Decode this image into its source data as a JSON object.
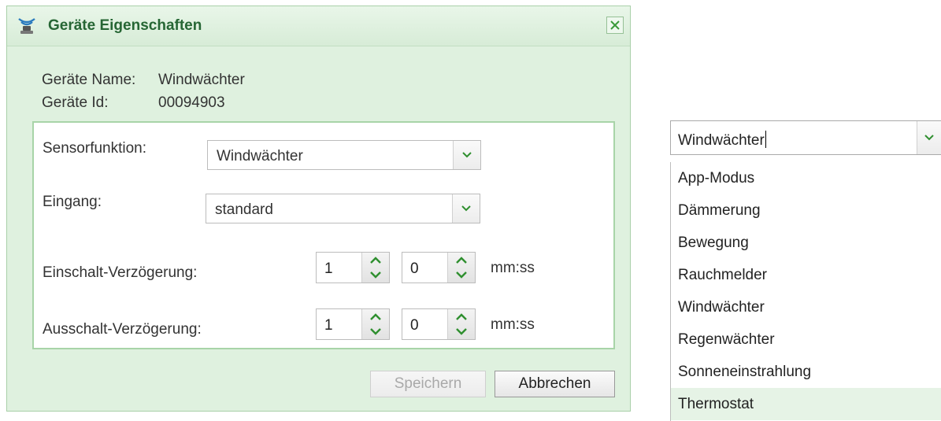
{
  "dialog": {
    "title": "Geräte Eigenschaften",
    "device_name_label": "Geräte Name:",
    "device_name_value": "Windwächter",
    "device_id_label": "Geräte Id:",
    "device_id_value": "00094903",
    "sensor_function": {
      "label": "Sensorfunktion:",
      "value": "Windwächter"
    },
    "input": {
      "label": "Eingang:",
      "value": "standard"
    },
    "on_delay": {
      "label": "Einschalt-Verzögerung:",
      "minutes": "1",
      "seconds": "0",
      "unit": "mm:ss"
    },
    "off_delay": {
      "label": "Ausschalt-Verzögerung:",
      "minutes": "1",
      "seconds": "0",
      "unit": "mm:ss"
    },
    "buttons": {
      "save": "Speichern",
      "cancel": "Abbrechen"
    }
  },
  "dropdown": {
    "value": "Windwächter",
    "options": [
      "App-Modus",
      "Dämmerung",
      "Bewegung",
      "Rauchmelder",
      "Windwächter",
      "Regenwächter",
      "Sonneneinstrahlung",
      "Thermostat"
    ],
    "highlighted": "Thermostat"
  },
  "colors": {
    "accent": "#266634",
    "dialog_bg": "#dff1df",
    "border": "#a8d4a8"
  }
}
